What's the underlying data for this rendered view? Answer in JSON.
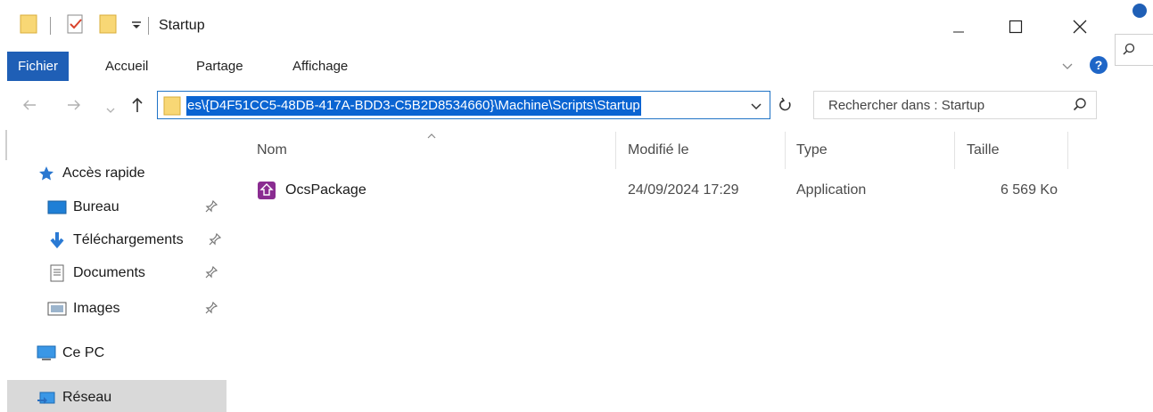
{
  "window": {
    "title": "Startup"
  },
  "ribbon": {
    "tabs": [
      "Fichier",
      "Accueil",
      "Partage",
      "Affichage"
    ]
  },
  "address": {
    "path": "es\\{D4F51CC5-48DB-417A-BDD3-C5B2D8534660}\\Machine\\Scripts\\Startup"
  },
  "search": {
    "placeholder": "Rechercher dans : Startup"
  },
  "nav": {
    "items": [
      {
        "label": "Accès rapide",
        "icon": "star-icon"
      },
      {
        "label": "Bureau",
        "icon": "desktop-icon",
        "pinned": true
      },
      {
        "label": "Téléchargements",
        "icon": "download-icon",
        "pinned": true
      },
      {
        "label": "Documents",
        "icon": "documents-icon",
        "pinned": true
      },
      {
        "label": "Images",
        "icon": "images-icon",
        "pinned": true
      },
      {
        "label": "Ce PC",
        "icon": "computer-icon"
      },
      {
        "label": "Réseau",
        "icon": "network-icon",
        "selected": true
      }
    ]
  },
  "columns": [
    "Nom",
    "Modifié le",
    "Type",
    "Taille"
  ],
  "files": [
    {
      "name": "OcsPackage",
      "modified": "24/09/2024 17:29",
      "type": "Application",
      "size": "6 569 Ko",
      "icon": "application-icon"
    }
  ],
  "colors": {
    "accent": "#1f5fb6",
    "selection": "#0a64d2",
    "nav_selected": "#d9d9d9"
  }
}
